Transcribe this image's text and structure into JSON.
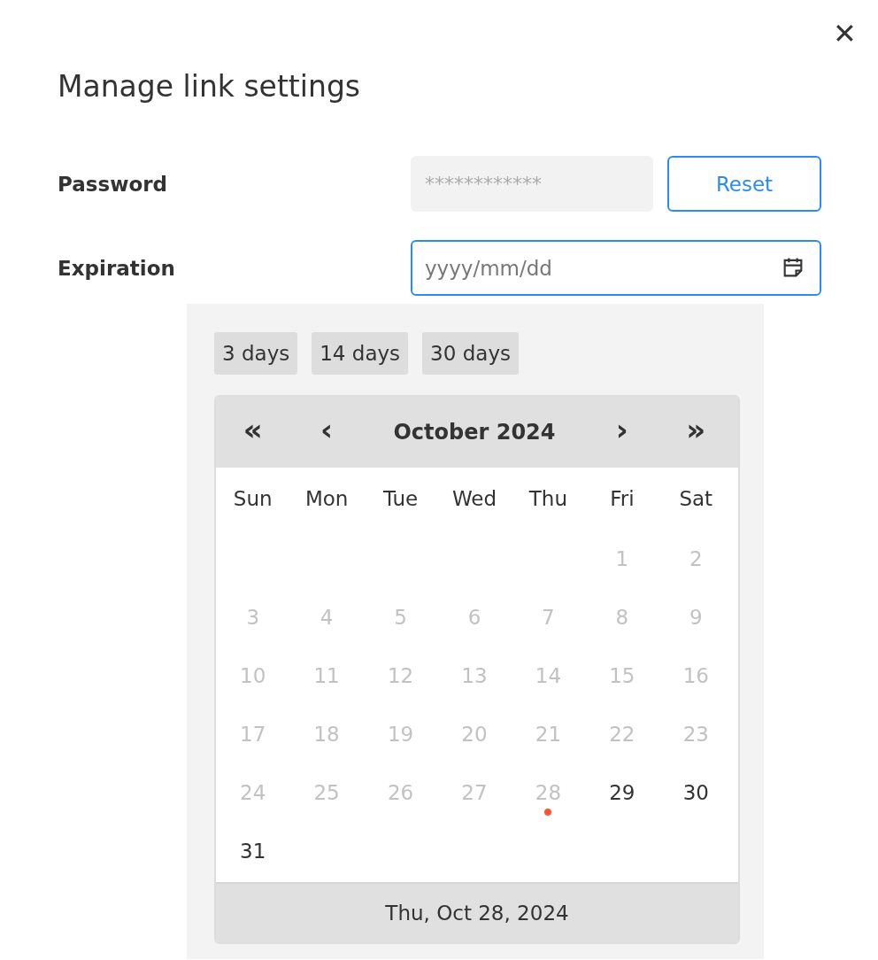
{
  "dialog": {
    "title": "Manage link settings",
    "close": "✕"
  },
  "password": {
    "label": "Password",
    "placeholder": "************",
    "button": "Reset"
  },
  "expiration": {
    "label": "Expiration",
    "placeholder": "yyyy/mm/dd",
    "focused": true
  },
  "quick_ranges": [
    "3 days",
    "14 days",
    "30 days"
  ],
  "calendar": {
    "nav": [
      "«",
      "‹",
      "›",
      "»"
    ],
    "month": "October 2024",
    "weekdays": [
      "Sun",
      "Mon",
      "Tue",
      "Wed",
      "Thu",
      "Fri",
      "Sat"
    ],
    "weeks": [
      {
        "days": [
          {
            "label": "1",
            "disabled": true,
            "today": false
          },
          {
            "label": "2",
            "disabled": true,
            "today": false
          }
        ]
      },
      {
        "days": [
          {
            "label": "3",
            "disabled": true,
            "today": false
          },
          {
            "label": "4",
            "disabled": true,
            "today": false
          },
          {
            "label": "5",
            "disabled": true,
            "today": false
          },
          {
            "label": "6",
            "disabled": true,
            "today": false
          },
          {
            "label": "7",
            "disabled": true,
            "today": false
          },
          {
            "label": "8",
            "disabled": true,
            "today": false
          },
          {
            "label": "9",
            "disabled": true,
            "today": false
          }
        ]
      },
      {
        "days": [
          {
            "label": "10",
            "disabled": true,
            "today": false
          },
          {
            "label": "11",
            "disabled": true,
            "today": false
          },
          {
            "label": "12",
            "disabled": true,
            "today": false
          },
          {
            "label": "13",
            "disabled": true,
            "today": false
          },
          {
            "label": "14",
            "disabled": true,
            "today": false
          },
          {
            "label": "15",
            "disabled": true,
            "today": false
          },
          {
            "label": "16",
            "disabled": true,
            "today": false
          }
        ]
      },
      {
        "days": [
          {
            "label": "17",
            "disabled": true,
            "today": false
          },
          {
            "label": "18",
            "disabled": true,
            "today": false
          },
          {
            "label": "19",
            "disabled": true,
            "today": false
          },
          {
            "label": "20",
            "disabled": true,
            "today": false
          },
          {
            "label": "21",
            "disabled": true,
            "today": false
          },
          {
            "label": "22",
            "disabled": true,
            "today": false
          },
          {
            "label": "23",
            "disabled": true,
            "today": false
          }
        ]
      },
      {
        "days": [
          {
            "label": "24",
            "disabled": true,
            "today": false
          },
          {
            "label": "25",
            "disabled": true,
            "today": false
          },
          {
            "label": "26",
            "disabled": true,
            "today": false
          },
          {
            "label": "27",
            "disabled": true,
            "today": false
          },
          {
            "label": "28",
            "disabled": true,
            "today": true
          },
          {
            "label": "29",
            "disabled": false,
            "today": false
          },
          {
            "label": "30",
            "disabled": false,
            "today": false
          }
        ]
      },
      {
        "days": [
          {
            "label": "31",
            "disabled": false,
            "today": false
          }
        ]
      }
    ],
    "footer": "Thu, Oct 28, 2024"
  }
}
